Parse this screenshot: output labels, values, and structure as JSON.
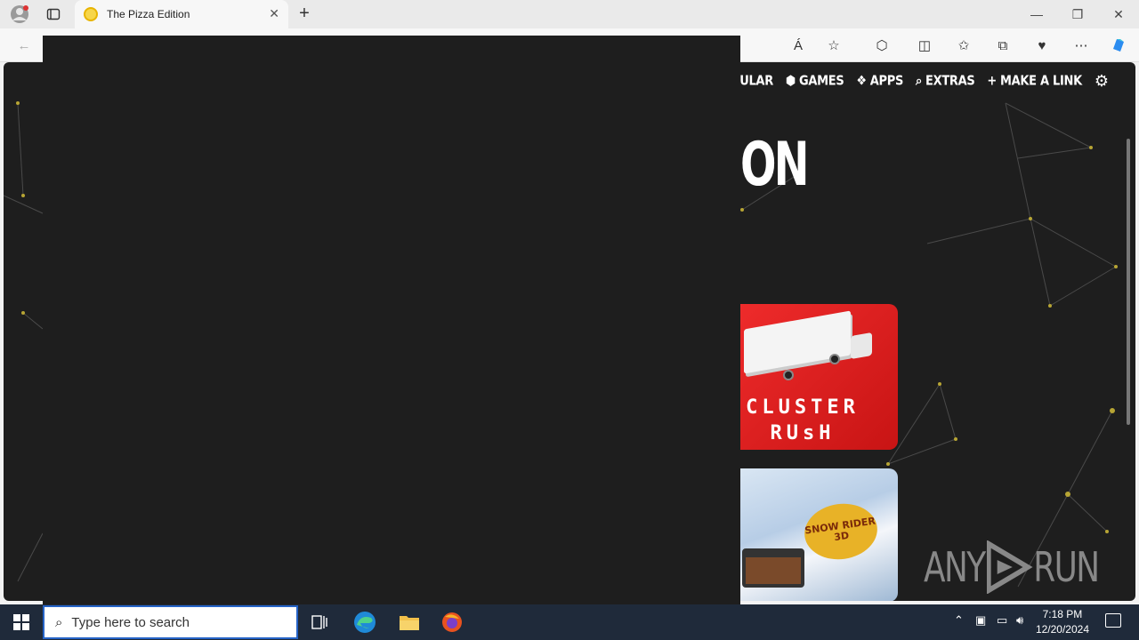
{
  "browser": {
    "tab_title": "The Pizza Edition",
    "tab_close": "✕",
    "new_tab": "+"
  },
  "nav": {
    "items": [
      {
        "label": "POPULAR",
        "icon": "flame-icon"
      },
      {
        "label": "GAMES",
        "icon": "gamepad-icon"
      },
      {
        "label": "APPS",
        "icon": "apps-icon"
      },
      {
        "label": "EXTRAS",
        "icon": "search-icon"
      },
      {
        "label": "MAKE A LINK",
        "icon": "plus-icon"
      }
    ]
  },
  "hero": {
    "title_fragment": "ON"
  },
  "cards": {
    "cluster": {
      "title_line1": "CLUSTER",
      "title_line2": "RUsH"
    },
    "snow": {
      "logo_text": "SNOW RIDER 3D"
    }
  },
  "watermark": {
    "text_a": "ANY",
    "text_b": "RUN"
  },
  "taskbar": {
    "search_placeholder": "Type here to search",
    "time": "7:18 PM",
    "date": "12/20/2024"
  },
  "colors": {
    "page_bg": "#1e1e1e",
    "cluster_red": "#e02020",
    "taskbar": "#1f2a3a",
    "accent": "#2563c7"
  }
}
